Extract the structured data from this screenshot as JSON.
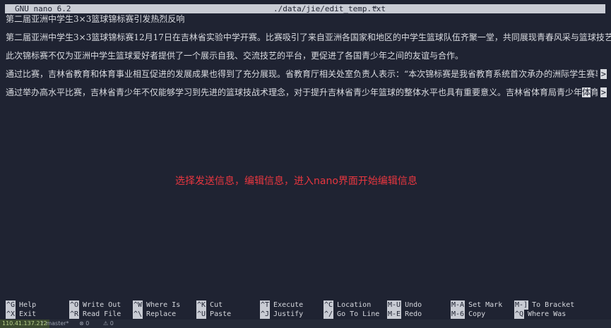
{
  "titlebar": {
    "app": "GNU nano 6.2",
    "file": "./data/jie/edit_temp.txt",
    "modified": "*"
  },
  "editor": {
    "lines": [
      "第二届亚洲中学生3×3篮球锦标赛引发热烈反响",
      "第二届亚洲中学生3×3篮球锦标赛12月17日在吉林省实验中学开赛。比赛吸引了来自亚洲各国家和地区的中学生篮球队伍齐聚一堂，共同展现青春风采与篮球技艺。",
      "此次锦标赛不仅为亚洲中学生篮球爱好者提供了一个展示自我、交流技艺的平台，更促进了各国青少年之间的友谊与合作。",
      "通过比赛，吉林省教育和体育事业相互促进的发展成果也得到了充分展现。省教育厅相关处室负责人表示：“本次锦标赛是我省教育系统首次承办的洲际学生赛事。下一步",
      "通过举办高水平比赛，吉林省青少年不仅能够学习到先进的篮球技战术理念，对于提升吉林省青少年篮球的整体水平也具有重要意义。吉林省体育局青少年"
    ],
    "line4_cursor_char": "体",
    "line4_after_cursor": "育处处长李崇",
    "overflow_marker": ">"
  },
  "annotation": "选择发送信息，编辑信息，进入nano界面开始编辑信息",
  "shortcuts": [
    {
      "key": "^G",
      "label": "Help"
    },
    {
      "key": "^X",
      "label": "Exit"
    },
    {
      "key": "^O",
      "label": "Write Out"
    },
    {
      "key": "^R",
      "label": "Read File"
    },
    {
      "key": "^W",
      "label": "Where Is"
    },
    {
      "key": "^\\",
      "label": "Replace"
    },
    {
      "key": "^K",
      "label": "Cut"
    },
    {
      "key": "^U",
      "label": "Paste"
    },
    {
      "key": "^T",
      "label": "Execute"
    },
    {
      "key": "^J",
      "label": "Justify"
    },
    {
      "key": "^C",
      "label": "Location"
    },
    {
      "key": "^/",
      "label": "Go To Line"
    },
    {
      "key": "M-U",
      "label": "Undo"
    },
    {
      "key": "M-E",
      "label": "Redo"
    },
    {
      "key": "M-A",
      "label": "Set Mark"
    },
    {
      "key": "M-6",
      "label": "Copy"
    },
    {
      "key": "M-]",
      "label": "To Bracket"
    },
    {
      "key": "^Q",
      "label": "Where Was"
    }
  ],
  "statusbar": {
    "ip": "110.41.137.212",
    "branch": "master*",
    "errors": "0",
    "warnings": "0",
    "colors": {
      "ip_bg": "#3b4a2e",
      "ip_fg": "#b8d08a"
    }
  },
  "colors": {
    "background": "#1f2332",
    "text": "#d9dbe0",
    "annotation": "#e8363f",
    "key_bg": "#c9ccd4"
  }
}
